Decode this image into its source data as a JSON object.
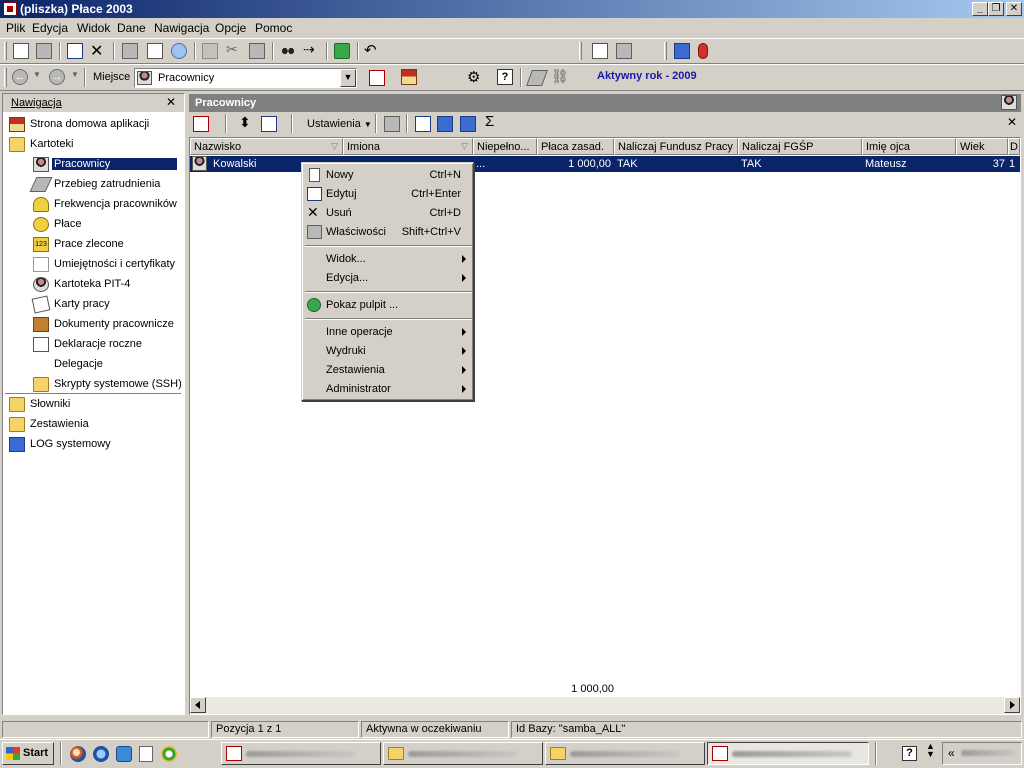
{
  "window": {
    "title": "(pliszka)  Płace 2003",
    "buttons": {
      "minimize": "_",
      "maximize": "❐",
      "close": "✕"
    }
  },
  "menubar": [
    "Plik",
    "Edycja",
    "Widok",
    "Dane",
    "Nawigacja",
    "Opcje",
    "Pomoc"
  ],
  "location": {
    "label": "Miejsce",
    "value": "Pracownicy",
    "active_year": "Aktywny rok - 2009"
  },
  "nav": {
    "title": "Nawigacja",
    "close": "✕",
    "items": [
      {
        "label": "Strona domowa aplikacji",
        "icon": "home-icon"
      },
      {
        "label": "Kartoteki",
        "icon": "folder-open-icon"
      },
      {
        "label": "Pracownicy",
        "icon": "employees-icon"
      },
      {
        "label": "Przebieg zatrudnienia",
        "icon": "employment-history-icon"
      },
      {
        "label": "Frekwencja pracowników",
        "icon": "attendance-icon"
      },
      {
        "label": "Płace",
        "icon": "payroll-icon"
      },
      {
        "label": "Prace zlecone",
        "icon": "contract-work-icon"
      },
      {
        "label": "Umiejętności i certyfikaty",
        "icon": "certificate-icon"
      },
      {
        "label": "Kartoteka PIT-4",
        "icon": "pit4-icon"
      },
      {
        "label": "Karty pracy",
        "icon": "work-cards-icon"
      },
      {
        "label": "Dokumenty pracownicze",
        "icon": "documents-icon"
      },
      {
        "label": "Deklaracje roczne",
        "icon": "annual-declarations-icon"
      },
      {
        "label": "Delegacje",
        "icon": ""
      },
      {
        "label": "Skrypty systemowe (SSH)",
        "icon": "folder-icon"
      },
      {
        "label": "Słowniki",
        "icon": "folder-icon"
      },
      {
        "label": "Zestawienia",
        "icon": "folder-icon"
      },
      {
        "label": "LOG systemowy",
        "icon": "log-icon"
      }
    ]
  },
  "page": {
    "title": "Pracownicy",
    "toolbar_settings": "Ustawienia",
    "sum_symbol": "Σ"
  },
  "grid": {
    "columns": [
      "Nazwisko",
      "Imiona",
      "Niepełno...",
      "Płaca zasad.",
      "Naliczaj Fundusz Pracy",
      "Naliczaj FGŚP",
      "Imię ojca",
      "Wiek",
      "D"
    ],
    "row": {
      "nazwisko": "Kowalski",
      "imiona": "",
      "niepelno": "...",
      "placa": "1 000,00",
      "fundusz": "TAK",
      "fgsp": "TAK",
      "ojciec": "Mateusz",
      "wiek": "37",
      "d": "1"
    },
    "footer_sum": "1 000,00"
  },
  "context_menu": {
    "items": [
      {
        "label": "Nowy",
        "shortcut": "Ctrl+N",
        "icon": "new-doc-icon"
      },
      {
        "label": "Edytuj",
        "shortcut": "Ctrl+Enter",
        "icon": "edit-icon"
      },
      {
        "label": "Usuń",
        "shortcut": "Ctrl+D",
        "icon": "delete-icon"
      },
      {
        "label": "Właściwości",
        "shortcut": "Shift+Ctrl+V",
        "icon": "properties-icon"
      },
      {
        "label": "Widok...",
        "submenu": true
      },
      {
        "label": "Edycja...",
        "submenu": true
      },
      {
        "label": "Pokaz pulpit ...",
        "icon": "desktop-icon"
      },
      {
        "label": "Inne operacje",
        "submenu": true
      },
      {
        "label": "Wydruki",
        "submenu": true
      },
      {
        "label": "Zestawienia",
        "submenu": true
      },
      {
        "label": "Administrator",
        "submenu": true
      }
    ]
  },
  "statusbar": {
    "position": "Pozycja 1 z 1",
    "state": "Aktywna w oczekiwaniu",
    "db": "Id Bazy: \"samba_ALL\""
  },
  "taskbar": {
    "start": "Start",
    "tray_more": "«"
  }
}
